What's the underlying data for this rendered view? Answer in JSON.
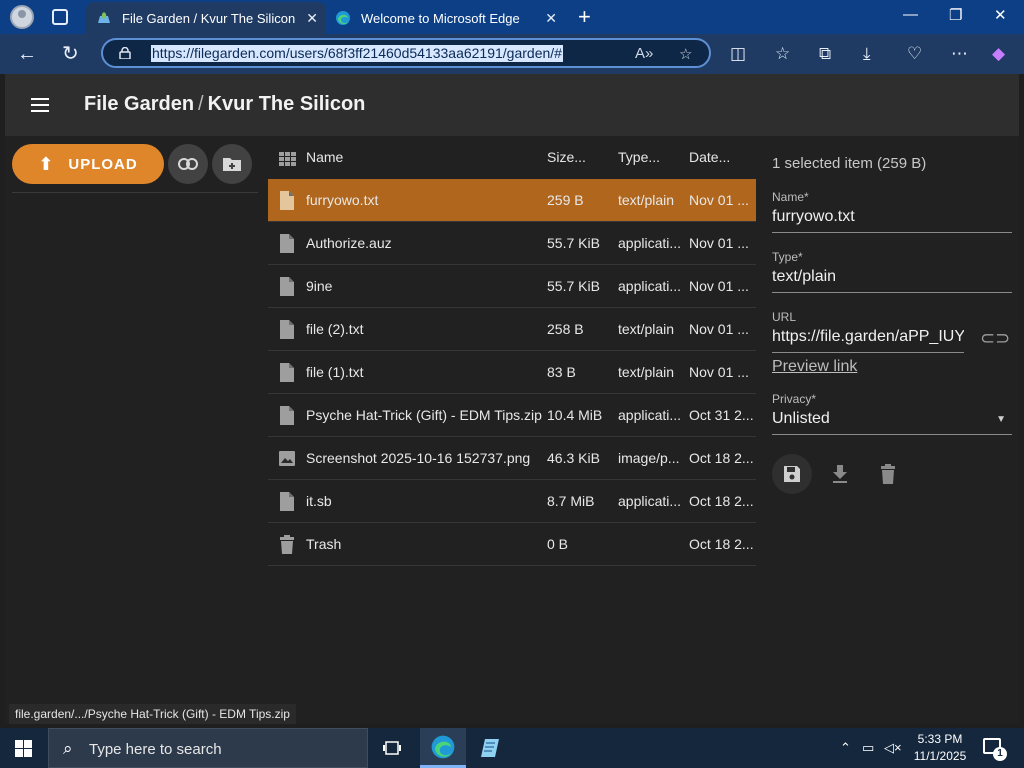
{
  "browser": {
    "tabs": [
      {
        "title": "File Garden / Kvur The Silicon",
        "active": true
      },
      {
        "title": "Welcome to Microsoft Edge",
        "active": false
      }
    ],
    "url": "https://filegarden.com/users/68f3ff21460d54133aa62191/garden/#"
  },
  "app": {
    "site_name": "File Garden",
    "separator": "/",
    "user_name": "Kvur The Silicon",
    "upload_label": "UPLOAD"
  },
  "file_list": {
    "columns": {
      "name": "Name",
      "size": "Size...",
      "type": "Type...",
      "date": "Date..."
    },
    "rows": [
      {
        "name": "furryowo.txt",
        "size": "259 B",
        "type": "text/plain",
        "date": "Nov 01 ...",
        "icon": "file-icon",
        "selected": true
      },
      {
        "name": "Authorize.auz",
        "size": "55.7 KiB",
        "type": "applicati...",
        "date": "Nov 01 ...",
        "icon": "file-icon"
      },
      {
        "name": "9ine",
        "size": "55.7 KiB",
        "type": "applicati...",
        "date": "Nov 01 ...",
        "icon": "file-icon"
      },
      {
        "name": "file (2).txt",
        "size": "258 B",
        "type": "text/plain",
        "date": "Nov 01 ...",
        "icon": "file-icon"
      },
      {
        "name": "file (1).txt",
        "size": "83 B",
        "type": "text/plain",
        "date": "Nov 01 ...",
        "icon": "file-icon"
      },
      {
        "name": "Psyche Hat-Trick (Gift) - EDM Tips.zip",
        "size": "10.4 MiB",
        "type": "applicati...",
        "date": "Oct 31 2...",
        "icon": "file-icon"
      },
      {
        "name": "Screenshot 2025-10-16 152737.png",
        "size": "46.3 KiB",
        "type": "image/p...",
        "date": "Oct 18 2...",
        "icon": "image-icon"
      },
      {
        "name": "it.sb",
        "size": "8.7 MiB",
        "type": "applicati...",
        "date": "Oct 18 2...",
        "icon": "file-icon"
      },
      {
        "name": "Trash",
        "size": "0 B",
        "type": "",
        "date": "Oct 18 2...",
        "icon": "trash-icon"
      }
    ]
  },
  "details": {
    "selection_summary": "1 selected item (259 B)",
    "name_label": "Name*",
    "name_value": "furryowo.txt",
    "type_label": "Type*",
    "type_value": "text/plain",
    "url_label": "URL",
    "url_value": "https://file.garden/aPP_IUY",
    "preview_link": "Preview link",
    "privacy_label": "Privacy*",
    "privacy_value": "Unlisted"
  },
  "status_bar": "file.garden/.../Psyche Hat-Trick (Gift) - EDM Tips.zip",
  "taskbar": {
    "search_placeholder": "Type here to search",
    "time": "5:33 PM",
    "date": "11/1/2025",
    "notification_count": "1"
  },
  "colors": {
    "accent_orange": "#e0862a",
    "selected_row": "#b0661c",
    "edge_blue": "#0c3f86"
  }
}
